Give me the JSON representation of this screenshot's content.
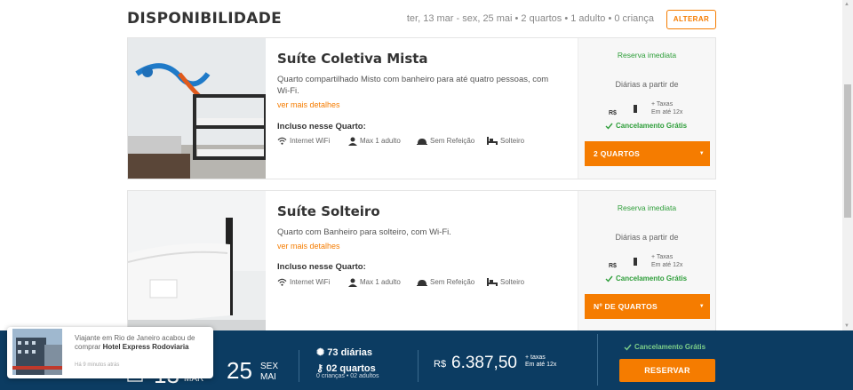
{
  "header": {
    "title": "DISPONIBILIDADE",
    "summary": "ter, 13 mar - sex, 25 mai • 2 quartos • 1 adulto • 0 criança",
    "alter_label": "ALTERAR"
  },
  "rooms": [
    {
      "title": "Suíte Coletiva Mista",
      "description": "Quarto compartilhado Misto com banheiro para até quatro pessoas, com Wi-Fi.",
      "more_link": "ver mais detalhes",
      "included_heading": "Incluso nesse Quarto:",
      "amenities": [
        {
          "icon": "wifi-icon",
          "label": "Internet WiFi"
        },
        {
          "icon": "person-icon",
          "label": "Max 1 adulto"
        },
        {
          "icon": "meal-icon",
          "label": "Sem Refeição"
        },
        {
          "icon": "bed-icon",
          "label": "Solteiro"
        }
      ],
      "booking_type": "Reserva imediata",
      "price_from_label": "Diárias a partir de",
      "currency": "R$",
      "taxes_line1": "+ Taxas",
      "taxes_line2": "Em até 12x",
      "cancellation": "Cancelamento Grátis",
      "quantity_select": "2 QUARTOS"
    },
    {
      "title": "Suíte Solteiro",
      "description": "Quarto com Banheiro para solteiro, com Wi-Fi.",
      "more_link": "ver mais detalhes",
      "included_heading": "Incluso nesse Quarto:",
      "amenities": [
        {
          "icon": "wifi-icon",
          "label": "Internet WiFi"
        },
        {
          "icon": "person-icon",
          "label": "Max 1 adulto"
        },
        {
          "icon": "meal-icon",
          "label": "Sem Refeição"
        },
        {
          "icon": "bed-icon",
          "label": "Solteiro"
        }
      ],
      "booking_type": "Reserva imediata",
      "price_from_label": "Diárias a partir de",
      "currency": "R$",
      "taxes_line1": "+ Taxas",
      "taxes_line2": "Em até 12x",
      "cancellation": "Cancelamento Grátis",
      "quantity_select": "Nº DE QUARTOS"
    }
  ],
  "bottom_bar": {
    "checkin_day": "13",
    "checkin_month": "MAR",
    "checkout_day": "25",
    "checkout_weekday": "SEX",
    "checkout_month": "MAI",
    "nights": "73 diárias",
    "rooms": "02 quartos",
    "guests": "0 crianças • 02 adultos",
    "currency": "R$",
    "total": "6.387,50",
    "taxes_line1": "+ taxas",
    "taxes_line2": "Em até 12x",
    "cancellation": "Cancelamento Grátis",
    "reserve_label": "RESERVAR"
  },
  "toast": {
    "message": "Viajante em Rio de Janeiro acabou de comprar",
    "hotel": "Hotel Express Rodoviaria",
    "time": "Há 9 minutos atrás"
  },
  "colors": {
    "accent": "#f57c00",
    "success": "#2e9e3a",
    "navy": "#0c3c62"
  }
}
